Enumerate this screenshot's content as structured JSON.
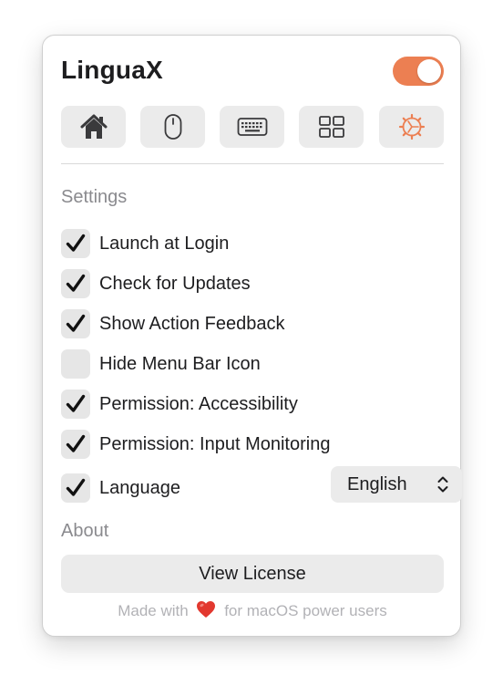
{
  "app": {
    "title": "LinguaX",
    "enabled": true,
    "accent_color": "#ec7f52"
  },
  "tabs": [
    {
      "icon": "house-icon",
      "active": false
    },
    {
      "icon": "mouse-icon",
      "active": false
    },
    {
      "icon": "keyboard-icon",
      "active": false
    },
    {
      "icon": "grid-icon",
      "active": false
    },
    {
      "icon": "gear-icon",
      "active": true
    }
  ],
  "settings": {
    "heading": "Settings",
    "items": [
      {
        "label": "Launch at Login",
        "checked": true
      },
      {
        "label": "Check for Updates",
        "checked": true
      },
      {
        "label": "Show Action Feedback",
        "checked": true
      },
      {
        "label": "Hide Menu Bar Icon",
        "checked": false
      },
      {
        "label": "Permission: Accessibility",
        "checked": true
      },
      {
        "label": "Permission: Input Monitoring",
        "checked": true
      },
      {
        "label": "Language",
        "checked": true
      }
    ],
    "language_select": {
      "value": "English"
    }
  },
  "about": {
    "heading": "About",
    "license_button": "View License",
    "footer_before": "Made with",
    "footer_heart": "heart-icon",
    "footer_after": "for macOS power users"
  }
}
